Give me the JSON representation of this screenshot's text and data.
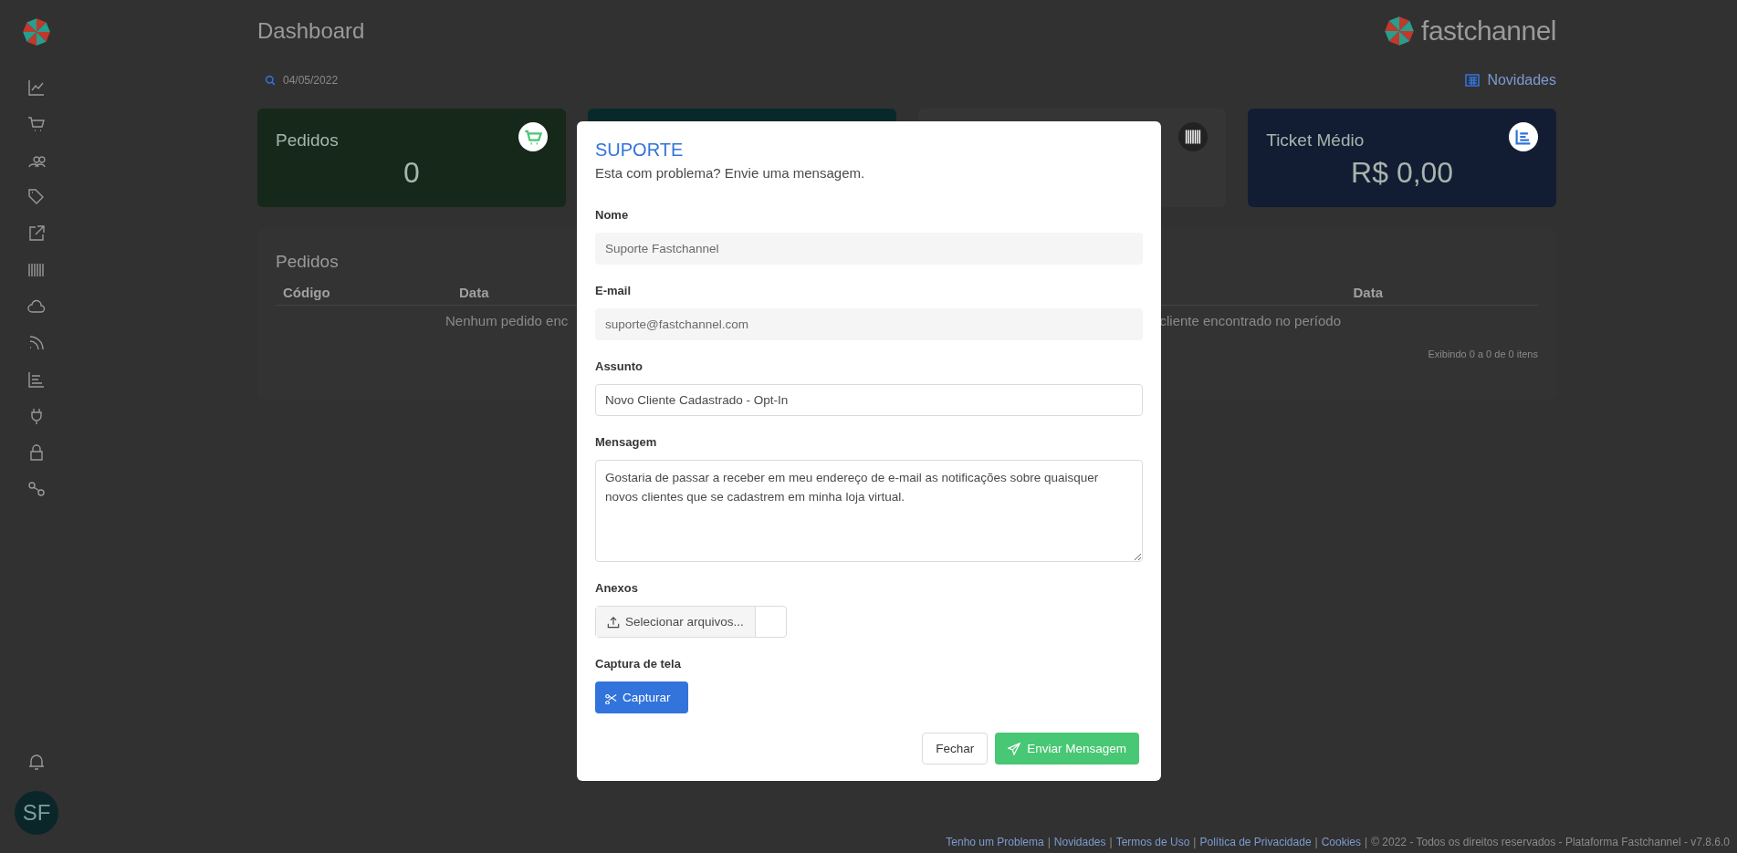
{
  "header": {
    "title": "Dashboard",
    "brand": "fastchannel"
  },
  "filter": {
    "date": "04/05/2022",
    "news_link": "Novidades"
  },
  "cards": [
    {
      "title": "Pedidos",
      "value": "0",
      "color": "#15281a",
      "kind": "cart"
    },
    {
      "color": "#08292a",
      "kind": "none"
    },
    {
      "color": "#353535",
      "kind": "barcode"
    },
    {
      "title": "Ticket Médio",
      "value": "R$ 0,00",
      "color": "#121d33",
      "kind": "chart"
    }
  ],
  "panels": [
    {
      "title": "Pedidos",
      "columns": [
        "Código",
        "Data"
      ],
      "empty": "Nenhum pedido enc"
    },
    {
      "columns": [
        "Data"
      ],
      "empty": "cliente encontrado no período",
      "summary": "Exibindo 0 a 0 de 0 itens"
    }
  ],
  "sidebar": {
    "avatar": "SF"
  },
  "modal": {
    "title": "SUPORTE",
    "subtitle": "Esta com problema? Envie uma mensagem.",
    "fields": [
      {
        "label": "Nome",
        "kind": "readonly",
        "value": "Suporte Fastchannel"
      },
      {
        "label": "E-mail",
        "kind": "readonly",
        "value": "suporte@fastchannel.com"
      },
      {
        "label": "Assunto",
        "kind": "text",
        "value": "Novo Cliente Cadastrado - Opt-In"
      },
      {
        "label": "Mensagem",
        "kind": "textarea",
        "value": "Gostaria de passar a receber em meu endereço de e-mail as notificações sobre quaisquer novos clientes que se cadastrem em minha loja virtual."
      },
      {
        "label": "Anexos",
        "kind": "file",
        "button": "Selecionar arquivos..."
      },
      {
        "label": "Captura de tela",
        "kind": "capture",
        "button": "Capturar"
      }
    ],
    "buttons": [
      {
        "label": "Fechar",
        "kind": "default"
      },
      {
        "label": "Enviar Mensagem",
        "kind": "primary"
      }
    ]
  },
  "footer": {
    "links": [
      "Tenho um Problema",
      "Novidades",
      "Termos de Uso",
      "Política de Privacidade",
      "Cookies"
    ],
    "separator": "|",
    "copyright": "© 2022 - Todos os direitos reservados - Plataforma Fastchannel - v7.8.6.0"
  }
}
